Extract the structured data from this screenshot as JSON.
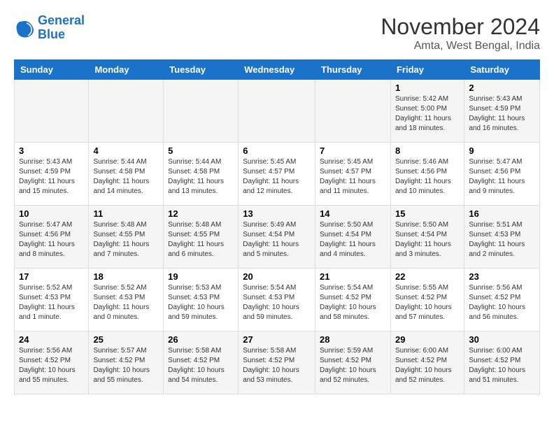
{
  "logo": {
    "line1": "General",
    "line2": "Blue"
  },
  "title": "November 2024",
  "location": "Amta, West Bengal, India",
  "weekdays": [
    "Sunday",
    "Monday",
    "Tuesday",
    "Wednesday",
    "Thursday",
    "Friday",
    "Saturday"
  ],
  "weeks": [
    [
      {
        "day": "",
        "info": ""
      },
      {
        "day": "",
        "info": ""
      },
      {
        "day": "",
        "info": ""
      },
      {
        "day": "",
        "info": ""
      },
      {
        "day": "",
        "info": ""
      },
      {
        "day": "1",
        "info": "Sunrise: 5:42 AM\nSunset: 5:00 PM\nDaylight: 11 hours\nand 18 minutes."
      },
      {
        "day": "2",
        "info": "Sunrise: 5:43 AM\nSunset: 4:59 PM\nDaylight: 11 hours\nand 16 minutes."
      }
    ],
    [
      {
        "day": "3",
        "info": "Sunrise: 5:43 AM\nSunset: 4:59 PM\nDaylight: 11 hours\nand 15 minutes."
      },
      {
        "day": "4",
        "info": "Sunrise: 5:44 AM\nSunset: 4:58 PM\nDaylight: 11 hours\nand 14 minutes."
      },
      {
        "day": "5",
        "info": "Sunrise: 5:44 AM\nSunset: 4:58 PM\nDaylight: 11 hours\nand 13 minutes."
      },
      {
        "day": "6",
        "info": "Sunrise: 5:45 AM\nSunset: 4:57 PM\nDaylight: 11 hours\nand 12 minutes."
      },
      {
        "day": "7",
        "info": "Sunrise: 5:45 AM\nSunset: 4:57 PM\nDaylight: 11 hours\nand 11 minutes."
      },
      {
        "day": "8",
        "info": "Sunrise: 5:46 AM\nSunset: 4:56 PM\nDaylight: 11 hours\nand 10 minutes."
      },
      {
        "day": "9",
        "info": "Sunrise: 5:47 AM\nSunset: 4:56 PM\nDaylight: 11 hours\nand 9 minutes."
      }
    ],
    [
      {
        "day": "10",
        "info": "Sunrise: 5:47 AM\nSunset: 4:56 PM\nDaylight: 11 hours\nand 8 minutes."
      },
      {
        "day": "11",
        "info": "Sunrise: 5:48 AM\nSunset: 4:55 PM\nDaylight: 11 hours\nand 7 minutes."
      },
      {
        "day": "12",
        "info": "Sunrise: 5:48 AM\nSunset: 4:55 PM\nDaylight: 11 hours\nand 6 minutes."
      },
      {
        "day": "13",
        "info": "Sunrise: 5:49 AM\nSunset: 4:54 PM\nDaylight: 11 hours\nand 5 minutes."
      },
      {
        "day": "14",
        "info": "Sunrise: 5:50 AM\nSunset: 4:54 PM\nDaylight: 11 hours\nand 4 minutes."
      },
      {
        "day": "15",
        "info": "Sunrise: 5:50 AM\nSunset: 4:54 PM\nDaylight: 11 hours\nand 3 minutes."
      },
      {
        "day": "16",
        "info": "Sunrise: 5:51 AM\nSunset: 4:53 PM\nDaylight: 11 hours\nand 2 minutes."
      }
    ],
    [
      {
        "day": "17",
        "info": "Sunrise: 5:52 AM\nSunset: 4:53 PM\nDaylight: 11 hours\nand 1 minute."
      },
      {
        "day": "18",
        "info": "Sunrise: 5:52 AM\nSunset: 4:53 PM\nDaylight: 11 hours\nand 0 minutes."
      },
      {
        "day": "19",
        "info": "Sunrise: 5:53 AM\nSunset: 4:53 PM\nDaylight: 10 hours\nand 59 minutes."
      },
      {
        "day": "20",
        "info": "Sunrise: 5:54 AM\nSunset: 4:53 PM\nDaylight: 10 hours\nand 59 minutes."
      },
      {
        "day": "21",
        "info": "Sunrise: 5:54 AM\nSunset: 4:52 PM\nDaylight: 10 hours\nand 58 minutes."
      },
      {
        "day": "22",
        "info": "Sunrise: 5:55 AM\nSunset: 4:52 PM\nDaylight: 10 hours\nand 57 minutes."
      },
      {
        "day": "23",
        "info": "Sunrise: 5:56 AM\nSunset: 4:52 PM\nDaylight: 10 hours\nand 56 minutes."
      }
    ],
    [
      {
        "day": "24",
        "info": "Sunrise: 5:56 AM\nSunset: 4:52 PM\nDaylight: 10 hours\nand 55 minutes."
      },
      {
        "day": "25",
        "info": "Sunrise: 5:57 AM\nSunset: 4:52 PM\nDaylight: 10 hours\nand 55 minutes."
      },
      {
        "day": "26",
        "info": "Sunrise: 5:58 AM\nSunset: 4:52 PM\nDaylight: 10 hours\nand 54 minutes."
      },
      {
        "day": "27",
        "info": "Sunrise: 5:58 AM\nSunset: 4:52 PM\nDaylight: 10 hours\nand 53 minutes."
      },
      {
        "day": "28",
        "info": "Sunrise: 5:59 AM\nSunset: 4:52 PM\nDaylight: 10 hours\nand 52 minutes."
      },
      {
        "day": "29",
        "info": "Sunrise: 6:00 AM\nSunset: 4:52 PM\nDaylight: 10 hours\nand 52 minutes."
      },
      {
        "day": "30",
        "info": "Sunrise: 6:00 AM\nSunset: 4:52 PM\nDaylight: 10 hours\nand 51 minutes."
      }
    ]
  ]
}
